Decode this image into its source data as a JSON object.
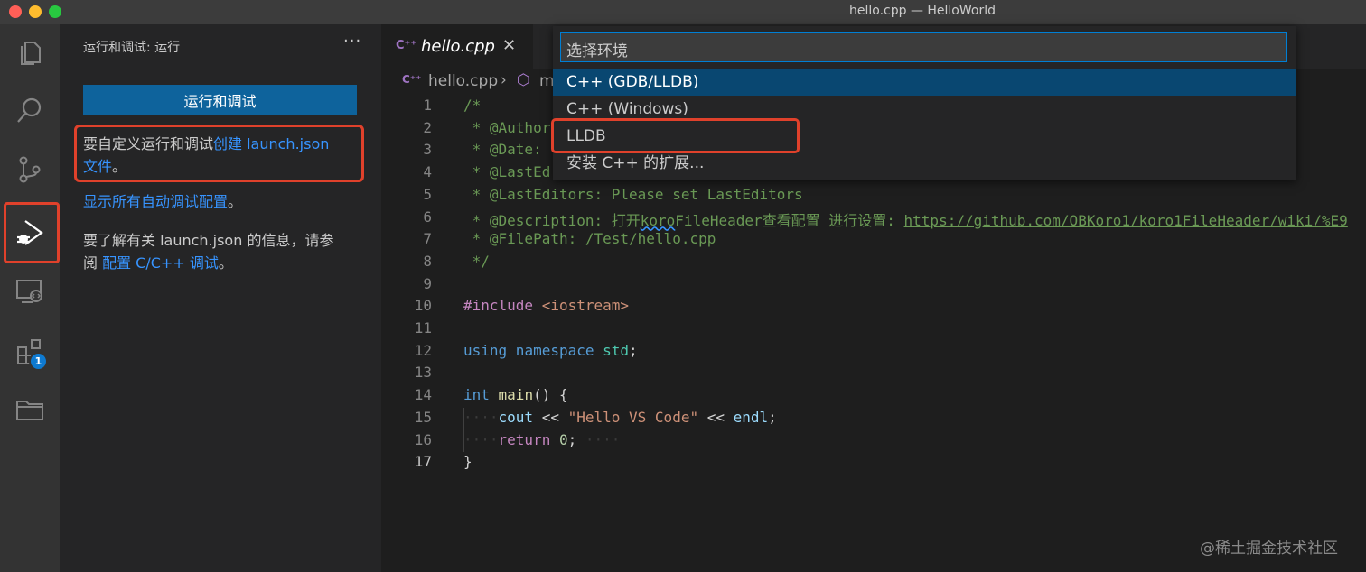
{
  "window": {
    "title": "hello.cpp — HelloWorld"
  },
  "activity_bar": {
    "items": [
      "explorer-icon",
      "search-icon",
      "source-control-icon",
      "run-debug-icon",
      "remote-explorer-icon",
      "extensions-icon",
      "folder-icon"
    ],
    "extensions_badge": "1"
  },
  "sidebar": {
    "title": "运行和调试: 运行",
    "more": "···",
    "run_button": "运行和调试",
    "custom_text": "要自定义运行和调试",
    "create_link": "创建 launch.json",
    "create_link_2": "文件",
    "period": "。",
    "show_all_link": "显示所有自动调试配置",
    "period2": "。",
    "learn_text_1": "要了解有关 launch.json 的信息，请参",
    "learn_text_2": "阅 ",
    "config_link": "配置 C/C++ 调试",
    "period3": "。"
  },
  "editor": {
    "tab_icon": "C⁺⁺",
    "tab_label": "hello.cpp",
    "tab_close": "✕",
    "breadcrumb_file": "hello.cpp",
    "breadcrumb_sep": "›",
    "breadcrumb_symbol": "m",
    "line_numbers": [
      "1",
      "2",
      "3",
      "4",
      "5",
      "6",
      "7",
      "8",
      "9",
      "10",
      "11",
      "12",
      "13",
      "14",
      "15",
      "16",
      "17"
    ],
    "lines": {
      "l1": "/*",
      "l2": " * @Author",
      "l3": " * @Date: ",
      "l4": " * @LastEd",
      "l5": " * @LastEditors: Please set LastEditors",
      "l6a": " * @Description: 打开",
      "l6b": "koro",
      "l6c": "FileHeader查看配置 进行设置: ",
      "l6d": "https://github.com/OBKoro1/koro1FileHeader/wiki/%E9",
      "l7": " * @FilePath: /Test/hello.cpp",
      "l8": " */",
      "l10a": "#include ",
      "l10b": "<iostream>",
      "l12a": "using",
      "l12b": " namespace ",
      "l12c": "std",
      "l12d": ";",
      "l14a": "int",
      "l14b": " main",
      "l14c": "() {",
      "l15ws": "····",
      "l15a": "cout",
      "l15b": " << ",
      "l15c": "\"Hello VS Code\"",
      "l15d": " << ",
      "l15e": "endl",
      "l15f": ";",
      "l16ws": "····",
      "l16a": "return",
      "l16b": " ",
      "l16c": "0",
      "l16d": ";",
      "l16ws2": " ····",
      "l17": "}"
    }
  },
  "quick_pick": {
    "placeholder": "选择环境",
    "items": [
      "C++ (GDB/LLDB)",
      "C++ (Windows)",
      "LLDB",
      "安装 C++ 的扩展..."
    ]
  },
  "watermark": "@稀土掘金技术社区"
}
